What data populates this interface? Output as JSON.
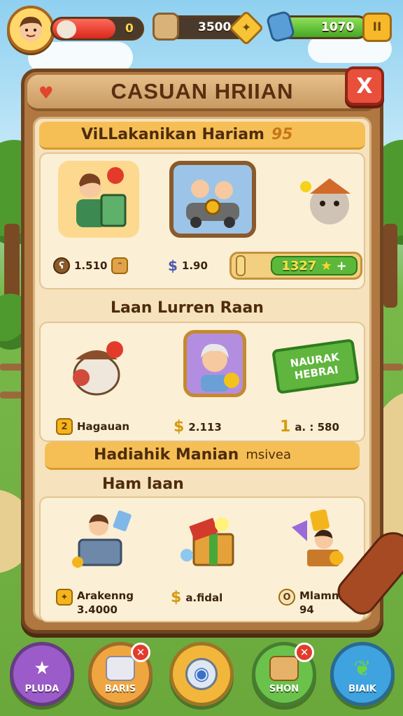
{
  "hud": {
    "level_label": "0",
    "gold_amount": "3500",
    "gem_amount": "1070",
    "pause_label": "II"
  },
  "panel": {
    "title": "CASUAN HRIIAN",
    "close_label": "X"
  },
  "section1": {
    "heading": "ViLLakanikan Hariam",
    "heading_number": "95",
    "items": [
      {
        "price": "1.510"
      },
      {
        "price": "1.90"
      },
      {
        "price": "1327"
      }
    ],
    "buy_plus": "+"
  },
  "section2": {
    "heading": "Laan Lurren Raan",
    "sign_text": "NAURAK HEBRAI",
    "items": [
      {
        "price": "Hagauan",
        "badge": "2"
      },
      {
        "price": "2.113",
        "badge": "$"
      },
      {
        "price": "a. : 580",
        "badge": "1"
      }
    ]
  },
  "section3": {
    "heading": "Hadiahik Manian",
    "heading_tail": "msivea",
    "subheading": "Ham laan",
    "items": [
      {
        "name": "Arakenng",
        "value": "3.4000"
      },
      {
        "name": "a.fidal",
        "value": ""
      },
      {
        "name": "Mlamnai",
        "value": "94"
      }
    ]
  },
  "nav": [
    {
      "label": "PLUDA",
      "color": "#9b5cc9"
    },
    {
      "label": "BARIS",
      "color": "#f0a640"
    },
    {
      "label": "",
      "color": "#f2b63a"
    },
    {
      "label": "SHON",
      "color": "#6bc24a"
    },
    {
      "label": "BIAIK",
      "color": "#3fa3e0"
    }
  ]
}
